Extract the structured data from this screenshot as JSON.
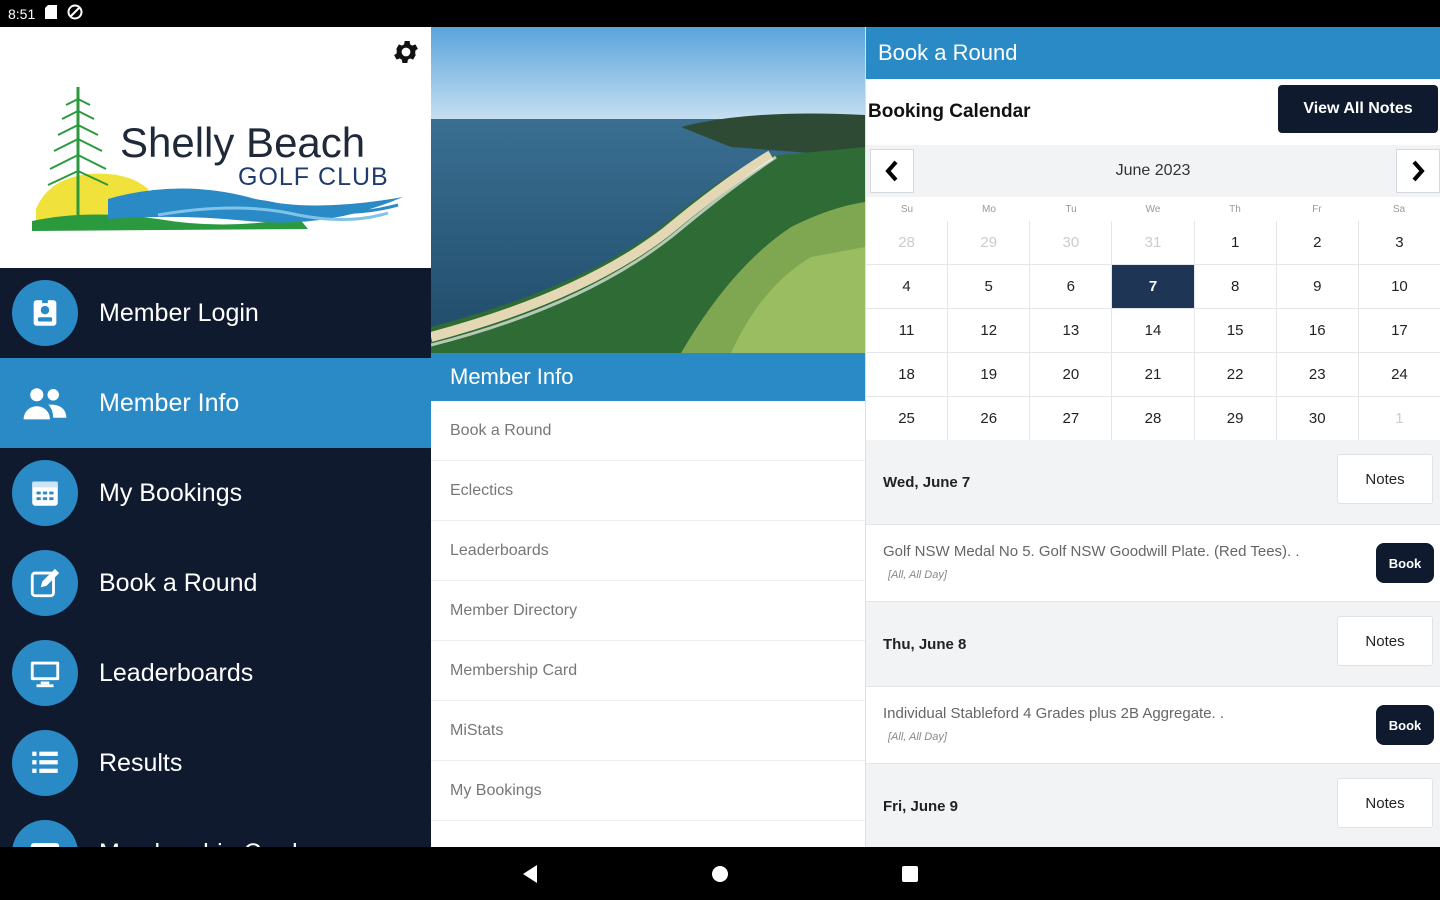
{
  "statusbar": {
    "time": "8:51"
  },
  "leftnav": {
    "logo": {
      "title": "Shelly Beach",
      "subtitle": "GOLF CLUB"
    },
    "items": [
      {
        "label": "Member Login",
        "icon": "badge-icon"
      },
      {
        "label": "Member Info",
        "icon": "users-icon",
        "active": true
      },
      {
        "label": "My Bookings",
        "icon": "calendar-icon"
      },
      {
        "label": "Book a Round",
        "icon": "edit-icon"
      },
      {
        "label": "Leaderboards",
        "icon": "monitor-icon"
      },
      {
        "label": "Results",
        "icon": "list-icon"
      },
      {
        "label": "Membership Card",
        "icon": "card-icon"
      }
    ]
  },
  "mid": {
    "header": "Member Info",
    "items": [
      "Book a Round",
      "Eclectics",
      "Leaderboards",
      "Member Directory",
      "Membership Card",
      "MiStats",
      "My Bookings"
    ]
  },
  "right": {
    "header": "Book a Round",
    "sub_title": "Booking Calendar",
    "view_notes_label": "View All Notes",
    "calendar": {
      "month": "June 2023",
      "dow": [
        "Su",
        "Mo",
        "Tu",
        "We",
        "Th",
        "Fr",
        "Sa"
      ],
      "days": [
        {
          "d": "28",
          "o": true
        },
        {
          "d": "29",
          "o": true
        },
        {
          "d": "30",
          "o": true
        },
        {
          "d": "31",
          "o": true
        },
        {
          "d": "1"
        },
        {
          "d": "2"
        },
        {
          "d": "3"
        },
        {
          "d": "4"
        },
        {
          "d": "5"
        },
        {
          "d": "6"
        },
        {
          "d": "7",
          "s": true
        },
        {
          "d": "8"
        },
        {
          "d": "9"
        },
        {
          "d": "10"
        },
        {
          "d": "11"
        },
        {
          "d": "12"
        },
        {
          "d": "13"
        },
        {
          "d": "14"
        },
        {
          "d": "15"
        },
        {
          "d": "16"
        },
        {
          "d": "17"
        },
        {
          "d": "18"
        },
        {
          "d": "19"
        },
        {
          "d": "20"
        },
        {
          "d": "21"
        },
        {
          "d": "22"
        },
        {
          "d": "23"
        },
        {
          "d": "24"
        },
        {
          "d": "25"
        },
        {
          "d": "26"
        },
        {
          "d": "27"
        },
        {
          "d": "28"
        },
        {
          "d": "29"
        },
        {
          "d": "30"
        },
        {
          "d": "1",
          "o": true
        }
      ]
    },
    "notes_label": "Notes",
    "book_label": "Book",
    "sessions": [
      {
        "date": "Wed, June 7",
        "event": "Golf NSW Medal No 5. Golf NSW Goodwill Plate. (Red Tees). .",
        "event_sub": "[All, All Day]"
      },
      {
        "date": "Thu, June 8",
        "event": "Individual Stableford 4 Grades plus 2B Aggregate. .",
        "event_sub": "[All, All Day]"
      },
      {
        "date": "Fri, June 9"
      }
    ]
  },
  "colors": {
    "accent": "#2a8ac6",
    "navy": "#0f1a2e"
  }
}
